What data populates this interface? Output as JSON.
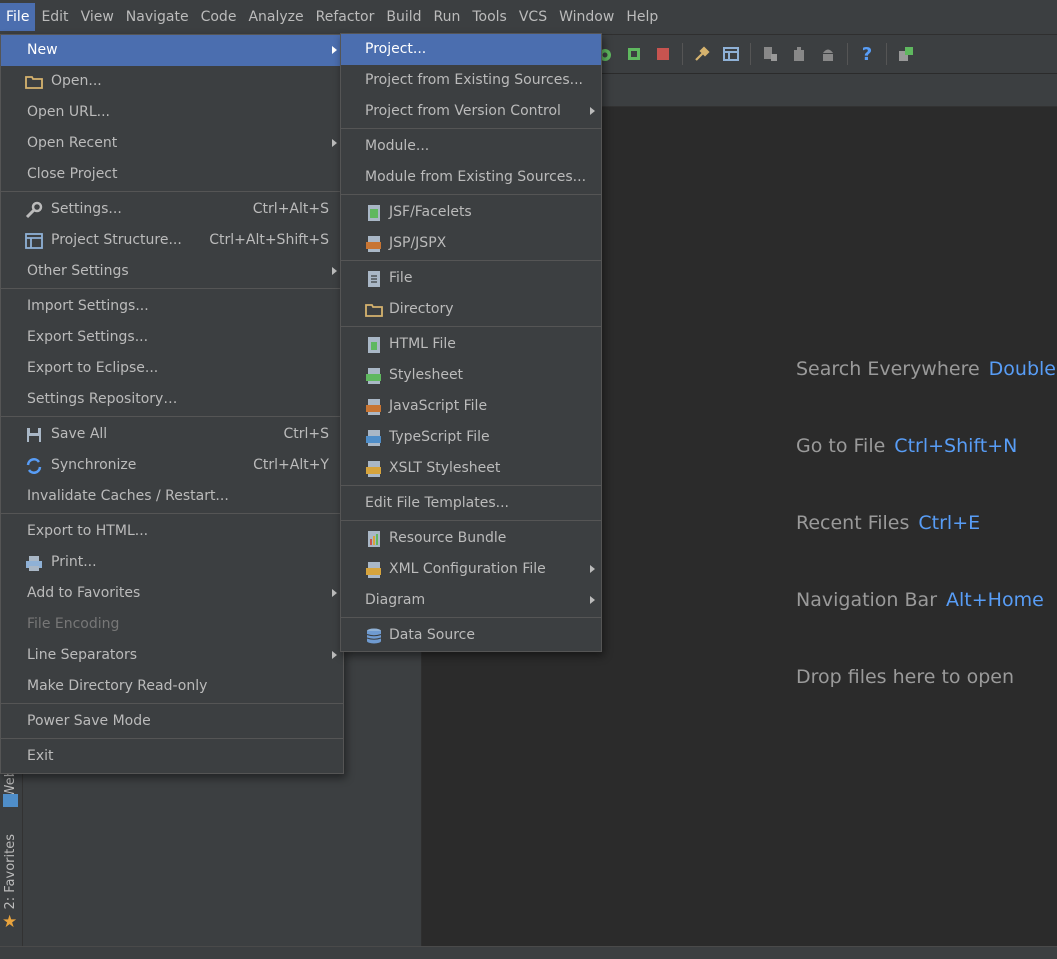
{
  "menubar": {
    "items": [
      {
        "label": "File"
      },
      {
        "label": "Edit"
      },
      {
        "label": "View"
      },
      {
        "label": "Navigate"
      },
      {
        "label": "Code"
      },
      {
        "label": "Analyze"
      },
      {
        "label": "Refactor"
      },
      {
        "label": "Build"
      },
      {
        "label": "Run"
      },
      {
        "label": "Tools"
      },
      {
        "label": "VCS"
      },
      {
        "label": "Window"
      },
      {
        "label": "Help"
      }
    ]
  },
  "file_menu": {
    "new": "New",
    "open": "Open...",
    "open_url": "Open URL...",
    "open_recent": "Open Recent",
    "close_project": "Close Project",
    "settings": "Settings...",
    "settings_sc": "Ctrl+Alt+S",
    "project_structure": "Project Structure...",
    "project_structure_sc": "Ctrl+Alt+Shift+S",
    "other_settings": "Other Settings",
    "import_settings": "Import Settings...",
    "export_settings": "Export Settings...",
    "export_eclipse": "Export to Eclipse...",
    "settings_repository": "Settings Repository…",
    "save_all": "Save All",
    "save_all_sc": "Ctrl+S",
    "synchronize": "Synchronize",
    "synchronize_sc": "Ctrl+Alt+Y",
    "invalidate": "Invalidate Caches / Restart...",
    "export_html": "Export to HTML...",
    "print": "Print...",
    "add_favorites": "Add to Favorites",
    "file_encoding": "File Encoding",
    "line_separators": "Line Separators",
    "make_readonly": "Make Directory Read-only",
    "power_save": "Power Save Mode",
    "exit": "Exit"
  },
  "new_menu": {
    "project": "Project...",
    "project_existing": "Project from Existing Sources...",
    "project_vcs": "Project from Version Control",
    "module": "Module...",
    "module_existing": "Module from Existing Sources...",
    "jsf": "JSF/Facelets",
    "jsp": "JSP/JSPX",
    "file": "File",
    "directory": "Directory",
    "html_file": "HTML File",
    "stylesheet": "Stylesheet",
    "javascript": "JavaScript File",
    "typescript": "TypeScript File",
    "xslt": "XSLT Stylesheet",
    "edit_templates": "Edit File Templates...",
    "resource_bundle": "Resource Bundle",
    "xml_config": "XML Configuration File",
    "diagram": "Diagram",
    "data_source": "Data Source"
  },
  "editor_hints": [
    {
      "text": "Search Everywhere",
      "key": "Double"
    },
    {
      "text": "Go to File",
      "key": "Ctrl+Shift+N"
    },
    {
      "text": "Recent Files",
      "key": "Ctrl+E"
    },
    {
      "text": "Navigation Bar",
      "key": "Alt+Home"
    },
    {
      "text": "Drop files here to open",
      "key": ""
    }
  ],
  "left_tabs": {
    "web": "Web",
    "favorites": "2: Favorites"
  },
  "colors": {
    "accent": "#4b6eaf",
    "link": "#589df6",
    "background": "#2b2b2b",
    "panel": "#3c3f41"
  }
}
